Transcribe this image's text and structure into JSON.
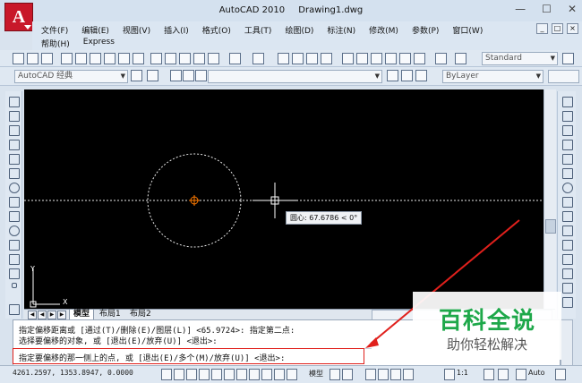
{
  "titlebar": {
    "app": "AutoCAD 2010",
    "file": "Drawing1.dwg",
    "logo_letter": "A",
    "minimize": "—",
    "maximize": "☐",
    "close": "✕"
  },
  "menu": {
    "row1": [
      "文件(F)",
      "编辑(E)",
      "视图(V)",
      "插入(I)",
      "格式(O)",
      "工具(T)",
      "绘图(D)",
      "标注(N)",
      "修改(M)",
      "参数(P)",
      "窗口(W)"
    ],
    "row2": [
      "帮助(H)",
      "Express"
    ],
    "mdi": [
      "_",
      "□",
      "×"
    ]
  },
  "toolbar": {
    "text_style": "Standard"
  },
  "toolbar2": {
    "workspace": "AutoCAD 经典",
    "layer_color": "ByLayer"
  },
  "canvas": {
    "tooltip": "圆心: 67.6786 < 0°",
    "ucs_x": "X",
    "ucs_y": "Y"
  },
  "layout_tabs": [
    "模型",
    "布局1",
    "布局2"
  ],
  "command": {
    "line1": "指定偏移距离或 [通过(T)/删除(E)/图层(L)] <65.9724>:   指定第二点:",
    "line2": "选择要偏移的对象, 或 [退出(E)/放弃(U)] <退出>:",
    "line3": "指定要偏移的那一侧上的点, 或 [退出(E)/多个(M)/放弃(U)] <退出>:"
  },
  "status": {
    "coords": "4261.2597, 1353.8947, 0.0000",
    "model": "模型",
    "scale": "1:1",
    "auto": "Auto"
  },
  "watermark": {
    "title": "百科全说",
    "subtitle": "助你轻松解决"
  },
  "colors": {
    "canvas": "#000000",
    "accent_red": "#e0201c",
    "watermark_green": "#1ea84a",
    "logo": "#c8182a"
  }
}
